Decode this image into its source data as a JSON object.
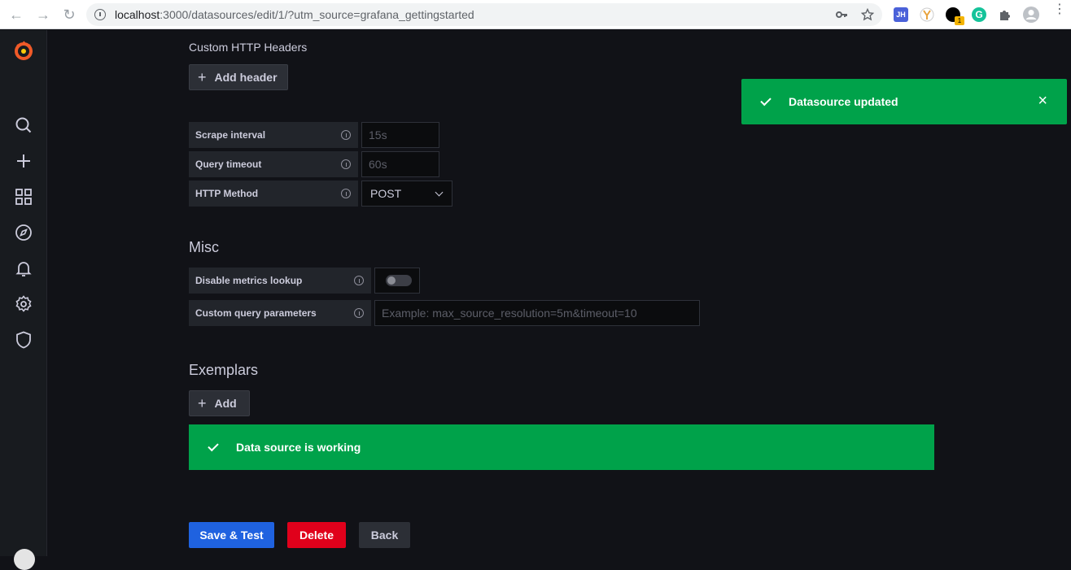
{
  "browser": {
    "url_host": "localhost",
    "url_rest": ":3000/datasources/edit/1/?utm_source=grafana_gettingstarted",
    "ext_jh": "JH",
    "ext_badge": "1"
  },
  "http": {
    "headers_title": "Custom HTTP Headers",
    "add_header_label": "Add header"
  },
  "fields": {
    "scrape_interval": {
      "label": "Scrape interval",
      "placeholder": "15s"
    },
    "query_timeout": {
      "label": "Query timeout",
      "placeholder": "60s"
    },
    "http_method": {
      "label": "HTTP Method",
      "value": "POST"
    }
  },
  "misc": {
    "title": "Misc",
    "disable_metrics_label": "Disable metrics lookup",
    "custom_query_label": "Custom query parameters",
    "custom_query_placeholder": "Example: max_source_resolution=5m&timeout=10"
  },
  "exemplars": {
    "title": "Exemplars",
    "add_label": "Add"
  },
  "status": {
    "working_text": "Data source is working"
  },
  "toast": {
    "text": "Datasource updated"
  },
  "actions": {
    "save_test": "Save & Test",
    "delete": "Delete",
    "back": "Back"
  },
  "colors": {
    "success": "#00a24a",
    "primary": "#1f62e0",
    "danger": "#e0001b"
  }
}
